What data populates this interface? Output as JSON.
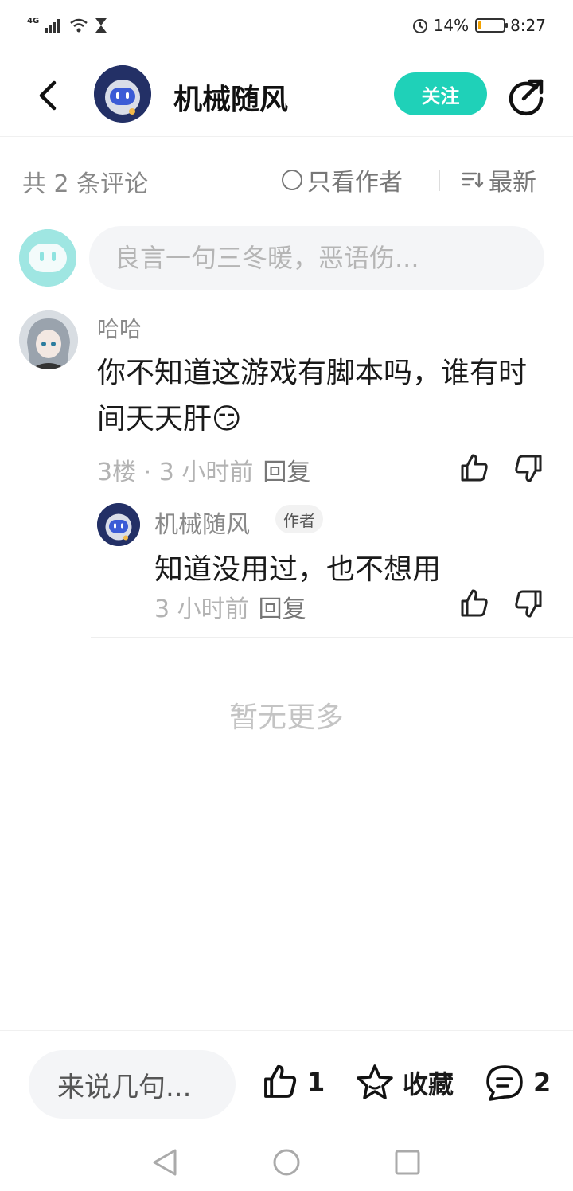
{
  "status": {
    "network": "4G",
    "battery_percent": "14%",
    "battery_level": 0.14,
    "time": "8:27"
  },
  "header": {
    "title": "机械随风",
    "follow_label": "关注"
  },
  "filter": {
    "count_label": "共 2 条评论",
    "author_only_label": "只看作者",
    "sort_label": "最新"
  },
  "input": {
    "placeholder": "良言一句三冬暖，恶语伤..."
  },
  "comments": [
    {
      "user": "哈哈",
      "text": "你不知道这游戏有脚本吗，谁有时间天天肝😏",
      "floor": "3楼 · 3 小时前",
      "reply_label": "回复",
      "replies": [
        {
          "user": "机械随风",
          "badge": "作者",
          "text": "知道没用过，也不想用",
          "time": "3 小时前",
          "reply_label": "回复"
        }
      ]
    }
  ],
  "footer_note": "暂无更多",
  "bottom_bar": {
    "say_label": "来说几句...",
    "like_count": "1",
    "favorite_label": "收藏",
    "comment_count": "2"
  },
  "colors": {
    "accent": "#1fd1b8",
    "battery": "#f2a100"
  },
  "icons": [
    "back-icon",
    "share-icon",
    "like-icon",
    "dislike-icon",
    "star-icon",
    "comment-icon",
    "nav-back-icon",
    "nav-home-icon",
    "nav-recent-icon"
  ]
}
